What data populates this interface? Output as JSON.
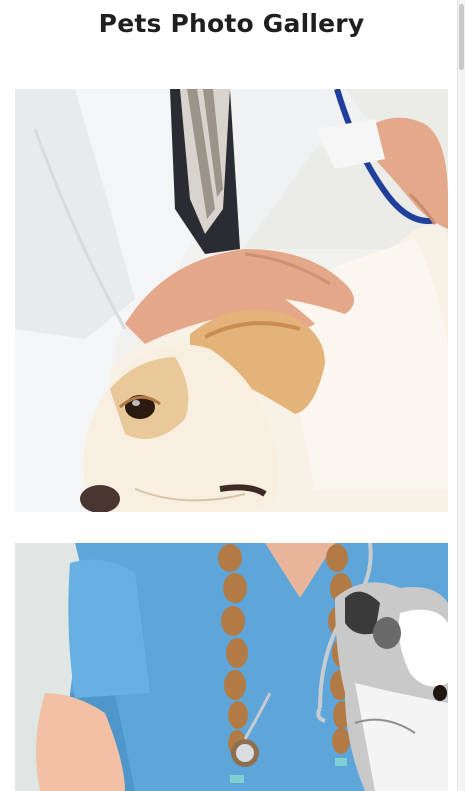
{
  "gallery": {
    "title": "Pets Photo Gallery"
  },
  "photos": [
    {
      "name": "veterinarian-examining-labrador",
      "icon": "photo-image"
    },
    {
      "name": "nurse-holding-puppy",
      "icon": "photo-image"
    }
  ],
  "colors": {
    "background": "#ffffff",
    "title": "#1f1f1f",
    "scrubs": "#5fa5d8",
    "dog_fur": "#f6eee2"
  }
}
